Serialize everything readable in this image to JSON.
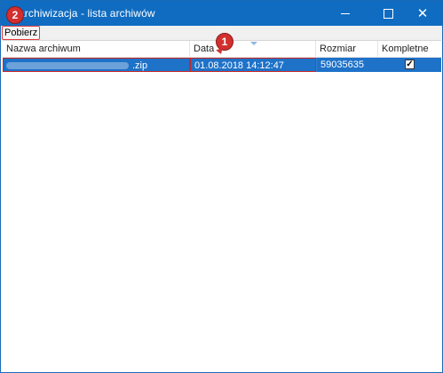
{
  "window": {
    "title": "archiwizacja - lista archiwów",
    "controls": {
      "minimize": "minimize-icon",
      "maximize": "maximize-icon",
      "close": "close-icon"
    }
  },
  "menu": {
    "download_label": "Pobierz"
  },
  "table": {
    "columns": [
      "Nazwa archiwum",
      "Data",
      "Rozmiar",
      "Kompletne"
    ],
    "rows": [
      {
        "name_suffix": ".zip",
        "date": "01.08.2018 14:12:47",
        "size": "59035635",
        "complete": true
      }
    ]
  },
  "annotations": {
    "badge_1": "1",
    "badge_2": "2"
  },
  "colors": {
    "titlebar": "#0f6cc1",
    "selection": "#1e72c8",
    "annotation": "#d32f2f"
  }
}
